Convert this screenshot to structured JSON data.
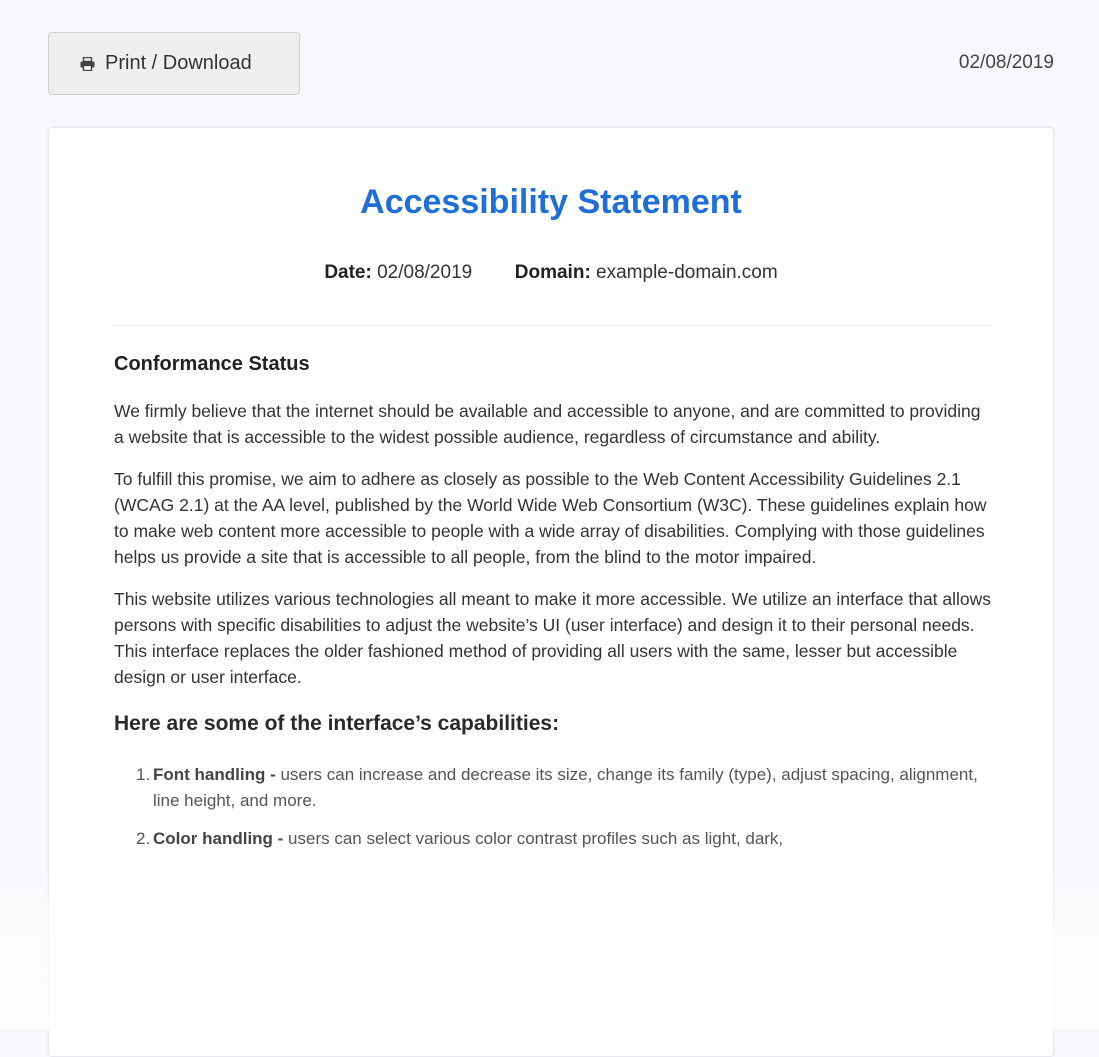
{
  "toolbar": {
    "print_label": "Print / Download",
    "date": "02/08/2019"
  },
  "statement": {
    "title": "Accessibility Statement",
    "date_label": "Date:",
    "date_value": "02/08/2019",
    "domain_label": "Domain:",
    "domain_value": "example-domain.com",
    "section_title": "Conformance Status",
    "paragraphs": [
      "We firmly believe that the internet should be available and accessible to anyone, and are committed to providing a website that is accessible to the widest possible audience, regardless of circumstance and ability.",
      "To fulfill this promise, we aim to adhere as closely as possible to the Web Content Accessibility Guidelines 2.1 (WCAG 2.1) at the AA level, published by the World Wide Web Consortium (W3C). These guidelines explain how to make web content more accessible to people with a wide array of disabilities. Complying with those guidelines helps us provide a site that is accessible to all people, from the blind to the motor impaired.",
      "This website utilizes various technologies all meant to make it more accessible. We utilize an interface that allows persons with specific disabilities to adjust the website’s UI (user interface) and design it to their personal needs. This interface replaces the older fashioned method of providing all users with the same, lesser but accessible design or user interface."
    ],
    "capabilities_title": "Here are some of the interface’s capabilities:",
    "capabilities": [
      {
        "num": "1.",
        "label": "Font handling -",
        "text": " users can increase and decrease its size, change its family (type), adjust spacing, alignment, line height, and more."
      },
      {
        "num": "2.",
        "label": "Color handling -",
        "text": " users can select various color contrast profiles such as light, dark,"
      }
    ]
  },
  "colors": {
    "accent": "#1e6fd9",
    "page_bg": "#f6f8fb"
  },
  "icons": {
    "print": "printer-icon"
  }
}
